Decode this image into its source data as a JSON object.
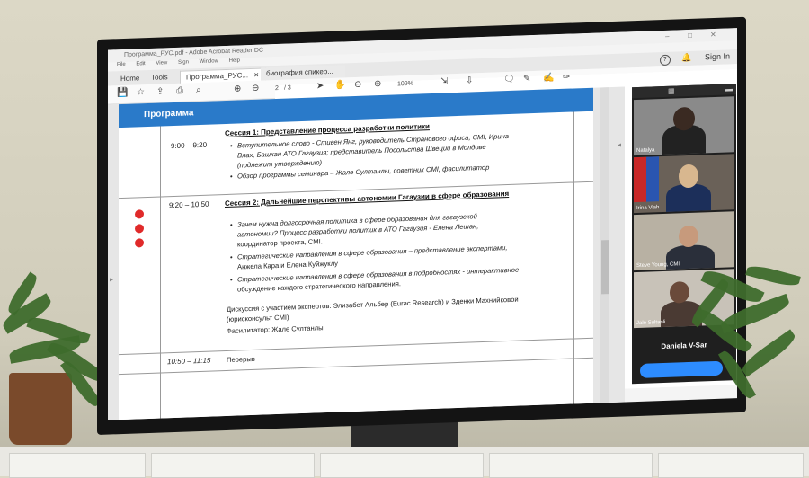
{
  "window": {
    "title": "Программа_РУС.pdf - Adobe Acrobat Reader DC",
    "controls": [
      "–",
      "□",
      "✕"
    ]
  },
  "menu": [
    "File",
    "Edit",
    "View",
    "Sign",
    "Window",
    "Help"
  ],
  "tabs": {
    "home": "Home",
    "tools": "Tools",
    "doc1": "Программа_РУС...",
    "doc1_close": "✕",
    "doc2": "биография спикер..."
  },
  "top_right": {
    "signin": "Sign In"
  },
  "toolbar": {
    "page_current": "2",
    "page_total": "/ 3",
    "zoom": "109%"
  },
  "document": {
    "header": "Программа",
    "rows": [
      {
        "time": "9:00 – 9:20",
        "session_title": "Сессия 1: Представление процесса разработки политики",
        "bullets": [
          "Вступительное слово - Стивен Янг, руководитель Странового офиса, CMI, Ирина",
          "Влах, Башкан АТО Гагаузия; представитель Посольства Швеции в Молдове",
          "(подлежит утверждению)",
          "Обзор программы семинара – Жале Султанлы, советник CMI, фасилитатор"
        ]
      },
      {
        "time": "9:20 – 10:50",
        "session_title": "Сессия 2: Дальнейшие перспективы автономии Гагаузии в сфере образования",
        "bullets": [
          "Зачем нужна долгосрочная политика в сфере образования для гагаузской",
          "автономии?  Процесс разработки политик в АТО Гагаузия - Елена Лешан,",
          "координатор проекта, CMI.",
          "Стратегические направления в сфере образования – представление экспертами,",
          "Анжела Кара и Елена Куйжуклу",
          "Стратегические направления в сфере образования в подробностях - интерактивное",
          "обсуждение каждого стратегического направления."
        ],
        "discussion": [
          "Дискуссия с участием экспертов: Элизабет Альбер (Eurac Research) и Зденки Махнийковой",
          "(юрисконсульт CMI)",
          "Фасилитатор: Жале Султанлы"
        ]
      },
      {
        "time": "10:50 – 11:15",
        "label": "Перерыв"
      }
    ]
  },
  "participants": [
    {
      "name": "Natalya"
    },
    {
      "name": "Irina Vlah"
    },
    {
      "name": "Steve Young, CMI"
    },
    {
      "name": "Jale Sultanli"
    }
  ],
  "active_speaker": "Daniela V-Sar",
  "colors": {
    "header_blue": "#2a7ac9",
    "dot_red": "#e02a2a",
    "zoom_blue": "#2d8cff"
  }
}
